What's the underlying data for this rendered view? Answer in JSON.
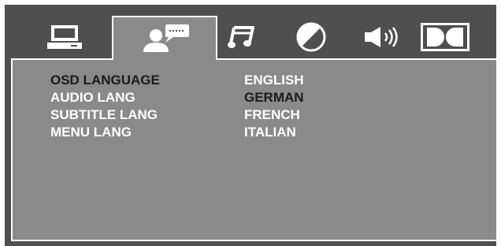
{
  "tabs": [
    {
      "icon": "monitor-icon",
      "label": "system"
    },
    {
      "icon": "person-speech-icon",
      "label": "language"
    },
    {
      "icon": "music-note-icon",
      "label": "audio"
    },
    {
      "icon": "half-circle-icon",
      "label": "video"
    },
    {
      "icon": "speaker-icon",
      "label": "speaker"
    },
    {
      "icon": "dolby-icon",
      "label": "digital"
    }
  ],
  "active_tab": 1,
  "settings": [
    {
      "label": "OSD LANGUAGE",
      "value": "ENGLISH"
    },
    {
      "label": "AUDIO LANG",
      "value": "GERMAN"
    },
    {
      "label": "SUBTITLE LANG",
      "value": "FRENCH"
    },
    {
      "label": "MENU LANG",
      "value": "ITALIAN"
    }
  ],
  "colors": {
    "background": "#4f4f4f",
    "panel": "#8a8a8a",
    "border": "#ffffff",
    "icon": "#ffffff",
    "text_light": "#ffffff",
    "text_dark": "#1a1a1a"
  }
}
